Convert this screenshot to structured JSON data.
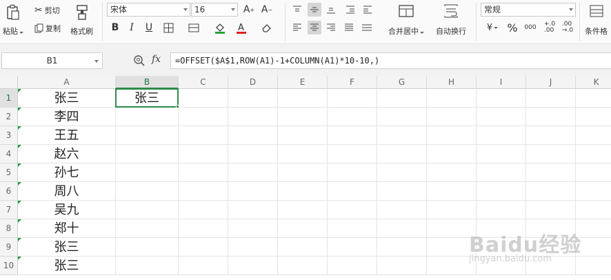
{
  "ribbon": {
    "paste_label": "粘贴",
    "cut_label": "剪切",
    "copy_label": "复制",
    "format_painter_label": "格式刷",
    "font_name": "宋体",
    "font_size": "16",
    "bold": "B",
    "italic": "I",
    "underline": "U",
    "merge_center_label": "合并居中",
    "wrap_text_label": "自动换行",
    "number_format": "常规",
    "conditional_format_label": "条件格",
    "percent": "%",
    "thousands": ",000",
    "inc_decimal": "+.0 .00",
    "dec_decimal": ".00 →.0",
    "icons": [
      "paste-icon",
      "cut-icon",
      "copy-icon",
      "format-painter-icon",
      "grow-font-icon",
      "shrink-font-icon",
      "border-icon",
      "fill-color-icon",
      "font-color-icon",
      "eraser-icon",
      "align-top-icon",
      "align-middle-icon",
      "align-bottom-icon",
      "indent-icon",
      "align-left-icon",
      "align-center-icon",
      "align-right-icon",
      "justify-icon",
      "distribute-icon",
      "merge-center-icon",
      "wrap-text-icon",
      "currency-icon",
      "percent-icon",
      "thousands-icon"
    ]
  },
  "formula_bar": {
    "name_box": "B1",
    "fx": "fx",
    "formula": "=OFFSET($A$1,ROW(A1)-1+COLUMN(A1)*10-10,)"
  },
  "columns": [
    "A",
    "B",
    "C",
    "D",
    "E",
    "F",
    "G",
    "H",
    "I",
    "J",
    "K"
  ],
  "selected_column": "B",
  "rows": [
    {
      "num": "1",
      "a": "张三",
      "b": "张三"
    },
    {
      "num": "2",
      "a": "李四",
      "b": ""
    },
    {
      "num": "3",
      "a": "王五",
      "b": ""
    },
    {
      "num": "4",
      "a": "赵六",
      "b": ""
    },
    {
      "num": "5",
      "a": "孙七",
      "b": ""
    },
    {
      "num": "6",
      "a": "周八",
      "b": ""
    },
    {
      "num": "7",
      "a": "吴九",
      "b": ""
    },
    {
      "num": "8",
      "a": "郑十",
      "b": ""
    },
    {
      "num": "9",
      "a": "张三",
      "b": ""
    },
    {
      "num": "10",
      "a": "张三",
      "b": ""
    }
  ],
  "watermark": {
    "line1": "Baidu经验",
    "line2": "jingyan.baidu.com"
  },
  "colors": {
    "accent": "#2e8a4a",
    "font_color_bar": "#e02020",
    "fill_color_bar": "#27a338"
  }
}
